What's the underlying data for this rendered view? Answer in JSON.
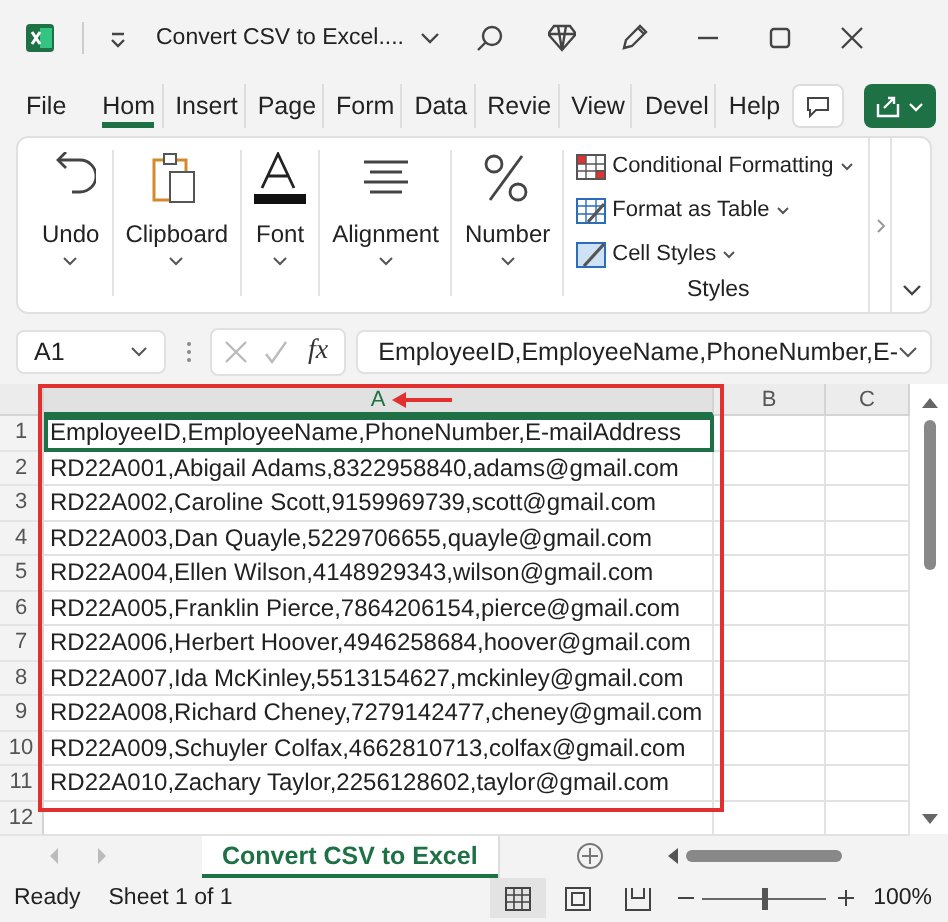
{
  "window": {
    "title": "Convert CSV to Excel...."
  },
  "ribbon_tabs": [
    {
      "label": "File",
      "selected": false
    },
    {
      "label": "Hom",
      "selected": true
    },
    {
      "label": "Insert",
      "selected": false
    },
    {
      "label": "Page",
      "selected": false
    },
    {
      "label": "Form",
      "selected": false
    },
    {
      "label": "Data",
      "selected": false
    },
    {
      "label": "Revie",
      "selected": false
    },
    {
      "label": "View",
      "selected": false
    },
    {
      "label": "Devel",
      "selected": false
    },
    {
      "label": "Help",
      "selected": false
    }
  ],
  "ribbon_groups": [
    {
      "kind": "undo",
      "label": "Undo"
    },
    {
      "kind": "clipboard",
      "label": "Clipboard"
    },
    {
      "kind": "font",
      "label": "Font"
    },
    {
      "kind": "alignment",
      "label": "Alignment"
    },
    {
      "kind": "number",
      "label": "Number"
    }
  ],
  "styles_group": {
    "label": "Styles",
    "items": [
      {
        "kind": "conditional",
        "label": "Conditional Formatting"
      },
      {
        "kind": "table",
        "label": "Format as Table"
      },
      {
        "kind": "cellstyles",
        "label": "Cell Styles"
      }
    ]
  },
  "formula_bar": {
    "name_box": "A1",
    "function_label": "fx",
    "formula": "EmployeeID,EmployeeName,PhoneNumber,E-"
  },
  "sheet": {
    "columns": [
      {
        "label": "A",
        "selected": true
      },
      {
        "label": "B",
        "selected": false
      },
      {
        "label": "C",
        "selected": false
      }
    ],
    "rows": [
      {
        "number": "1",
        "value": "EmployeeID,EmployeeName,PhoneNumber,E-mailAddress",
        "selected": true
      },
      {
        "number": "2",
        "value": "RD22A001,Abigail Adams,8322958840,adams@gmail.com",
        "selected": false
      },
      {
        "number": "3",
        "value": "RD22A002,Caroline Scott,9159969739,scott@gmail.com",
        "selected": false
      },
      {
        "number": "4",
        "value": "RD22A003,Dan Quayle,5229706655,quayle@gmail.com",
        "selected": false
      },
      {
        "number": "5",
        "value": "RD22A004,Ellen Wilson,4148929343,wilson@gmail.com",
        "selected": false
      },
      {
        "number": "6",
        "value": "RD22A005,Franklin Pierce,7864206154,pierce@gmail.com",
        "selected": false
      },
      {
        "number": "7",
        "value": "RD22A006,Herbert Hoover,4946258684,hoover@gmail.com",
        "selected": false
      },
      {
        "number": "8",
        "value": "RD22A007,Ida McKinley,5513154627,mckinley@gmail.com",
        "selected": false
      },
      {
        "number": "9",
        "value": "RD22A008,Richard Cheney,7279142477,cheney@gmail.com",
        "selected": false
      },
      {
        "number": "10",
        "value": "RD22A009,Schuyler Colfax,4662810713,colfax@gmail.com",
        "selected": false
      },
      {
        "number": "11",
        "value": "RD22A010,Zachary Taylor,2256128602,taylor@gmail.com",
        "selected": false
      },
      {
        "number": "12",
        "selected": false
      }
    ]
  },
  "sheet_tabs": [
    {
      "label": "Convert CSV to Excel",
      "selected": true
    }
  ],
  "status_bar": {
    "status": "Ready",
    "sheet_info": "Sheet 1 of 1",
    "views": [
      {
        "kind": "normal",
        "selected": true
      },
      {
        "kind": "layout",
        "selected": false
      },
      {
        "kind": "break",
        "selected": false
      }
    ],
    "zoom_slider": {
      "level": 0.5
    },
    "zoom": "100%"
  }
}
